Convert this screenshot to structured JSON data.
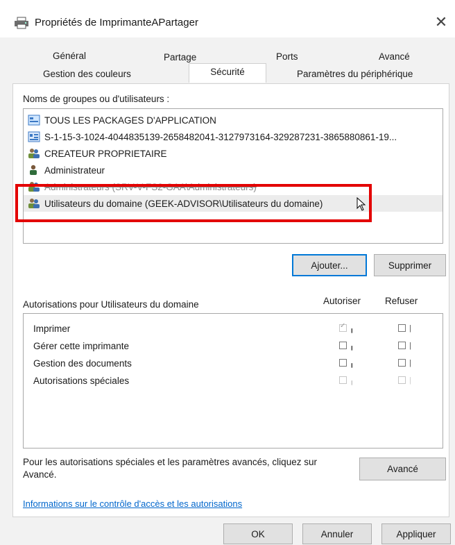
{
  "window": {
    "title": "Propriétés de ImprimanteAPartager",
    "close_symbol": "✕"
  },
  "tabs": {
    "row1": [
      "Général",
      "Partage",
      "Ports",
      "Avancé"
    ],
    "row2": [
      "Gestion des couleurs",
      "Sécurité",
      "Paramètres du périphérique"
    ],
    "active": "Sécurité"
  },
  "groups": {
    "label": "Noms de groupes ou d'utilisateurs :",
    "items": [
      {
        "label": "TOUS LES PACKAGES D'APPLICATION",
        "icon": "app-packages-icon"
      },
      {
        "label": "S-1-15-3-1024-4044835139-2658482041-3127973164-329287231-3865880861-19...",
        "icon": "sid-icon"
      },
      {
        "label": "CREATEUR PROPRIETAIRE",
        "icon": "users-group-icon"
      },
      {
        "label": "Administrateur",
        "icon": "user-icon"
      },
      {
        "label": "Administrateurs (SRV-V-FS2-GAA\\Administrateurs)",
        "icon": "users-group-icon"
      },
      {
        "label": "Utilisateurs du domaine (GEEK-ADVISOR\\Utilisateurs du domaine)",
        "icon": "users-group-icon"
      }
    ],
    "selected_index": 5
  },
  "buttons": {
    "add": "Ajouter...",
    "remove": "Supprimer",
    "advanced": "Avancé",
    "ok": "OK",
    "cancel": "Annuler",
    "apply": "Appliquer"
  },
  "permissions": {
    "label": "Autorisations pour Utilisateurs du domaine",
    "allow_header": "Autoriser",
    "deny_header": "Refuser",
    "rows": [
      {
        "name": "Imprimer",
        "allow": true,
        "deny": false
      },
      {
        "name": "Gérer cette imprimante",
        "allow": false,
        "deny": false
      },
      {
        "name": "Gestion des documents",
        "allow": false,
        "deny": false
      },
      {
        "name": "Autorisations spéciales",
        "allow": false,
        "deny": false
      }
    ]
  },
  "special_text": "Pour les autorisations spéciales et les paramètres avancés, cliquez sur Avancé.",
  "info_link": "Informations sur le contrôle d'accès et les autorisations",
  "colors": {
    "highlight": "#e30000",
    "link": "#0066cc",
    "focus": "#0078d7"
  }
}
